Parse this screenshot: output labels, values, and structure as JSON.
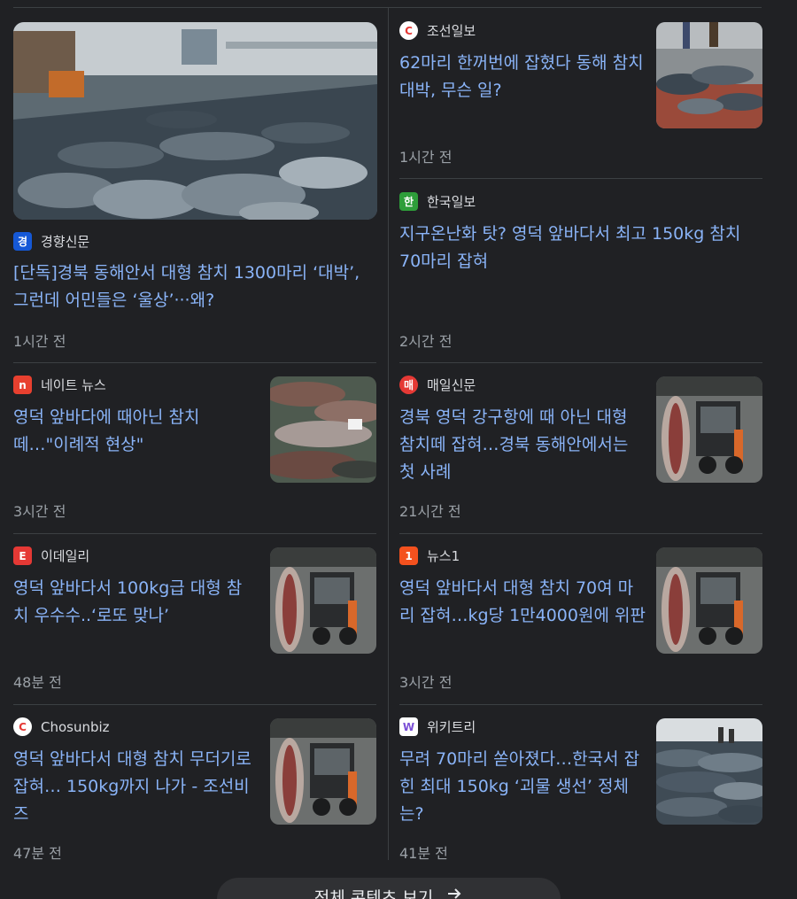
{
  "articles": [
    {
      "source": "경향신문",
      "title": "[단독]경북 동해안서 대형 참치 1300마리 ‘대박’, 그런데 어민들은 ‘울상’···왜?",
      "time": "1시간 전",
      "favicon_color": "#1558d6",
      "favicon_glyph": "경"
    },
    {
      "source": "조선일보",
      "title": "62마리 한꺼번에 잡혔다 동해 참치 대박, 무슨 일?",
      "time": "1시간 전",
      "favicon_color": "#e53935",
      "favicon_glyph": "C"
    },
    {
      "source": "한국일보",
      "title": "지구온난화 탓? 영덕 앞바다서 최고 150kg 참치 70마리 잡혀",
      "time": "2시간 전",
      "favicon_color": "#2e9e3a",
      "favicon_glyph": "한"
    },
    {
      "source": "네이트 뉴스",
      "title": "영덕 앞바다에 때아닌 참치떼…\"이례적 현상\"",
      "time": "3시간 전",
      "favicon_color": "#e8402f",
      "favicon_glyph": "n"
    },
    {
      "source": "매일신문",
      "title": "경북 영덕 강구항에 때 아닌 대형 참치떼 잡혀…경북 동해안에서는 첫 사례",
      "time": "21시간 전",
      "favicon_color": "#e53935",
      "favicon_glyph": "매"
    },
    {
      "source": "이데일리",
      "title": "영덕 앞바다서 100kg급 대형 참치 우수수..‘로또 맞나’",
      "time": "48분 전",
      "favicon_color": "#e53935",
      "favicon_glyph": "E"
    },
    {
      "source": "뉴스1",
      "title": "영덕 앞바다서 대형 참치 70여 마리 잡혀…kg당 1만4000원에 위판",
      "time": "3시간 전",
      "favicon_color": "#f4511e",
      "favicon_glyph": "1"
    },
    {
      "source": "Chosunbiz",
      "title": "영덕 앞바다서 대형 참치 무더기로 잡혀… 150kg까지 나가 - 조선비즈",
      "time": "47분 전",
      "favicon_color": "#e53935",
      "favicon_glyph": "C"
    },
    {
      "source": "위키트리",
      "title": "무려 70마리 쏟아졌다…한국서 잡힌 최대 150kg ‘괴물 생선’ 정체는?",
      "time": "41분 전",
      "favicon_color": "#7b4fd6",
      "favicon_glyph": "W"
    }
  ],
  "more_button": {
    "label": "전체 콘텐츠 보기",
    "icon": "arrow-right-icon"
  }
}
